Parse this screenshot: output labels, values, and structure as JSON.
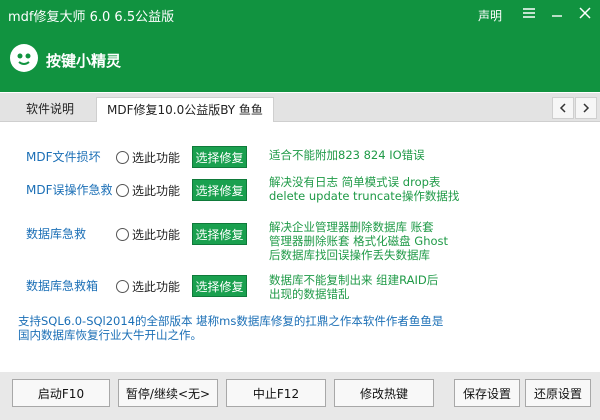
{
  "window": {
    "title": "mdf修复大师 6.0 6.5公益版",
    "declare": "声明",
    "brand": "按键小精灵"
  },
  "tabs": [
    {
      "label": "软件说明"
    },
    {
      "label": "MDF修复10.0公益版BY 鱼鱼"
    }
  ],
  "rows": [
    {
      "label": "MDF文件损坏",
      "radio": "选此功能",
      "button": "选择修复",
      "desc": [
        "适合不能附加823 824 IO错误"
      ]
    },
    {
      "label": "MDF误操作急救",
      "radio": "选此功能",
      "button": "选择修复",
      "desc": [
        "解决没有日志 简单模式误 drop表",
        "delete update  truncate操作数据找"
      ]
    },
    {
      "label": "数据库急救",
      "radio": "选此功能",
      "button": "选择修复",
      "desc": [
        "解决企业管理器删除数据库 账套",
        "管理器删除账套 格式化磁盘 Ghost",
        "后数据库找回误操作丢失数据库"
      ]
    },
    {
      "label": "数据库急救箱",
      "radio": "选此功能",
      "button": "选择修复",
      "desc": [
        "数据库不能复制出来 组建RAID后",
        "出现的数据错乱"
      ]
    }
  ],
  "support": [
    "支持SQL6.0-SQl2014的全部版本 堪称ms数据库修复的扛鼎之作本软件作者鱼鱼是",
    "国内数据库恢复行业大牛开山之作。"
  ],
  "bottom_buttons": [
    "启动F10",
    "暂停/继续<无>",
    "中止F12",
    "修改热键",
    "保存设置",
    "还原设置"
  ]
}
